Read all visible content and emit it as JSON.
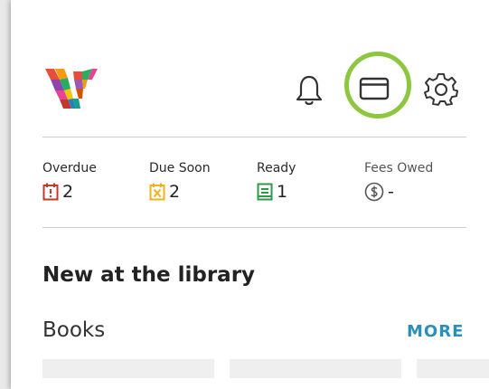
{
  "header": {
    "logo_name": "library-logo",
    "icons": [
      "bell-icon",
      "library-card-icon",
      "gear-icon"
    ],
    "highlight_color": "#8dc63f"
  },
  "stats": [
    {
      "label": "Overdue",
      "value": "2",
      "icon": "overdue-calendar-icon",
      "color": "#c0392b"
    },
    {
      "label": "Due Soon",
      "value": "2",
      "icon": "due-soon-calendar-icon",
      "color": "#f2b01e"
    },
    {
      "label": "Ready",
      "value": "1",
      "icon": "ready-book-icon",
      "color": "#2e9a47"
    },
    {
      "label": "Fees Owed",
      "value": "-",
      "icon": "dollar-circle-icon",
      "color": "#555555"
    }
  ],
  "section": {
    "title": "New at the library"
  },
  "books": {
    "title": "Books",
    "more_label": "MORE"
  },
  "colors": {
    "link": "#2a8fbd",
    "divider": "#cfcfcf"
  }
}
